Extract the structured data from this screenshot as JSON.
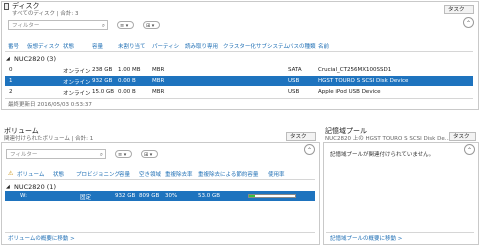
{
  "disk": {
    "title": "ディスク",
    "subtitle": "すべてのディスク | 合計: 3",
    "task_label": "タスク",
    "filter_placeholder": "フィルター",
    "columns": [
      "番号",
      "仮想ディスク",
      "状態",
      "容量",
      "未割り当て",
      "パーティシ",
      "読み取り専用",
      "クラスター化",
      "サブシステム",
      "バスの種類",
      "名前"
    ],
    "group": "NUC2820 (3)",
    "rows": [
      {
        "num": "0",
        "status": "オンライン",
        "capacity": "238 GB",
        "unallocated": "1.00 MB",
        "partition": "MBR",
        "bus": "SATA",
        "name": "Crucial_CT256MX100SSD1",
        "selected": false
      },
      {
        "num": "1",
        "status": "オンライン",
        "capacity": "932 GB",
        "unallocated": "0.00 B",
        "partition": "MBR",
        "bus": "USB",
        "name": "HGST TOURO S SCSI Disk Device",
        "selected": true
      },
      {
        "num": "2",
        "status": "オンライン",
        "capacity": "15.0 GB",
        "unallocated": "0.00 B",
        "partition": "MBR",
        "bus": "USB",
        "name": "Apple iPod USB Device",
        "selected": false
      }
    ],
    "last_updated": "最終更新日 2016/05/03 0:53:37"
  },
  "volume": {
    "title": "ボリューム",
    "subtitle": "関連付けられたボリューム | 合計: 1",
    "task_label": "タスク",
    "filter_placeholder": "フィルター",
    "columns": [
      "ボリューム",
      "状態",
      "プロビジョニング",
      "容量",
      "空き領域",
      "重複除去率",
      "重複除去による節約容量",
      "使用率"
    ],
    "group": "NUC2820 (1)",
    "row": {
      "volume": "W:",
      "provisioning": "固定",
      "capacity": "932 GB",
      "free": "809 GB",
      "dedup_rate": "30%",
      "dedup_savings": "53.0 GB",
      "usage_fraction": 0.13
    },
    "footer_link": "ボリュームの概要に移動 >"
  },
  "storage_pool": {
    "title": "記憶域プール",
    "subtitle": "NUC2820 上の HGST TOURO S SCSI Disk De...",
    "task_label": "タスク",
    "empty_message": "記憶域プールが関連付けられていません。",
    "footer_link": "記憶域プールの概要に移動 >"
  },
  "colors": {
    "accent": "#1f6fb5",
    "selection": "#1e73be",
    "usage_fill": "#3cc03c"
  },
  "icons": {
    "clear": "close-icon",
    "collapse": "chevron-up-icon",
    "expand_group": "triangle-icon"
  }
}
